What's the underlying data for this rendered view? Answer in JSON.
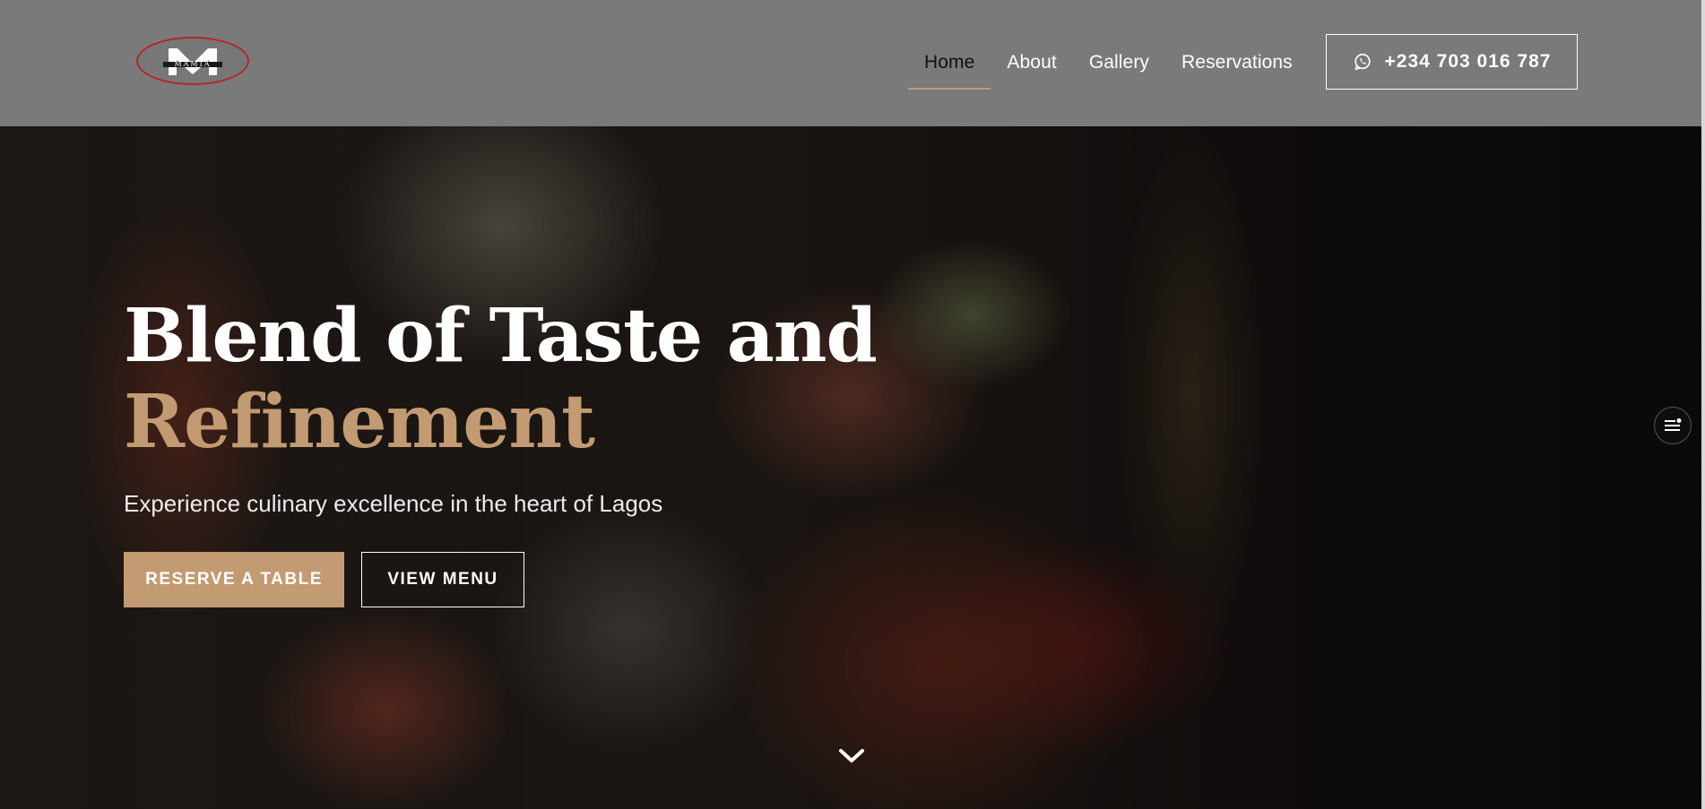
{
  "header": {
    "logo_text": "MAMIA",
    "nav": [
      {
        "label": "Home",
        "active": true
      },
      {
        "label": "About",
        "active": false
      },
      {
        "label": "Gallery",
        "active": false
      },
      {
        "label": "Reservations",
        "active": false
      }
    ],
    "phone": "+234 703 016 787",
    "phone_icon": "whatsapp-icon"
  },
  "hero": {
    "title_line1": "Blend of Taste and",
    "title_line2": "Refinement",
    "subtitle": "Experience culinary excellence in the heart of Lagos",
    "primary_button": "RESERVE A TABLE",
    "secondary_button": "VIEW MENU",
    "scroll_icon": "chevron-down-icon"
  },
  "side_widget_icon": "menu-lines-icon",
  "colors": {
    "header_bg": "#7a7a7a",
    "accent": "#c39b72",
    "logo_ring": "#b3262e"
  }
}
